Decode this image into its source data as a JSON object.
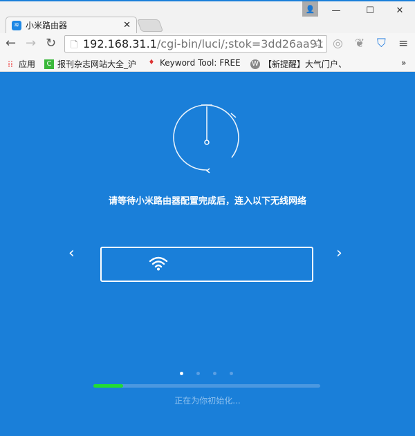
{
  "window": {
    "minimize": "—",
    "maximize": "☐",
    "close": "✕"
  },
  "tab": {
    "title": "小米路由器",
    "close": "✕"
  },
  "address": {
    "host": "192.168.31.1",
    "path": "/cgi-bin/luci/;stok=3dd26aa91"
  },
  "bookmarks": [
    {
      "label": "应用"
    },
    {
      "label": "报刊杂志网站大全_沪"
    },
    {
      "label": "Keyword Tool: FREE"
    },
    {
      "label": "【新提醒】大气门户、"
    }
  ],
  "bookmarks_more": "»",
  "main": {
    "message": "请等待小米路由器配置完成后，连入以下无线网络",
    "prev": "‹",
    "next": "›",
    "status": "正在为你初始化...",
    "progress_percent": 13,
    "carousel_pages": 4,
    "carousel_active": 0
  },
  "colors": {
    "background": "#1a7fd9",
    "progress": "#22dd33"
  }
}
